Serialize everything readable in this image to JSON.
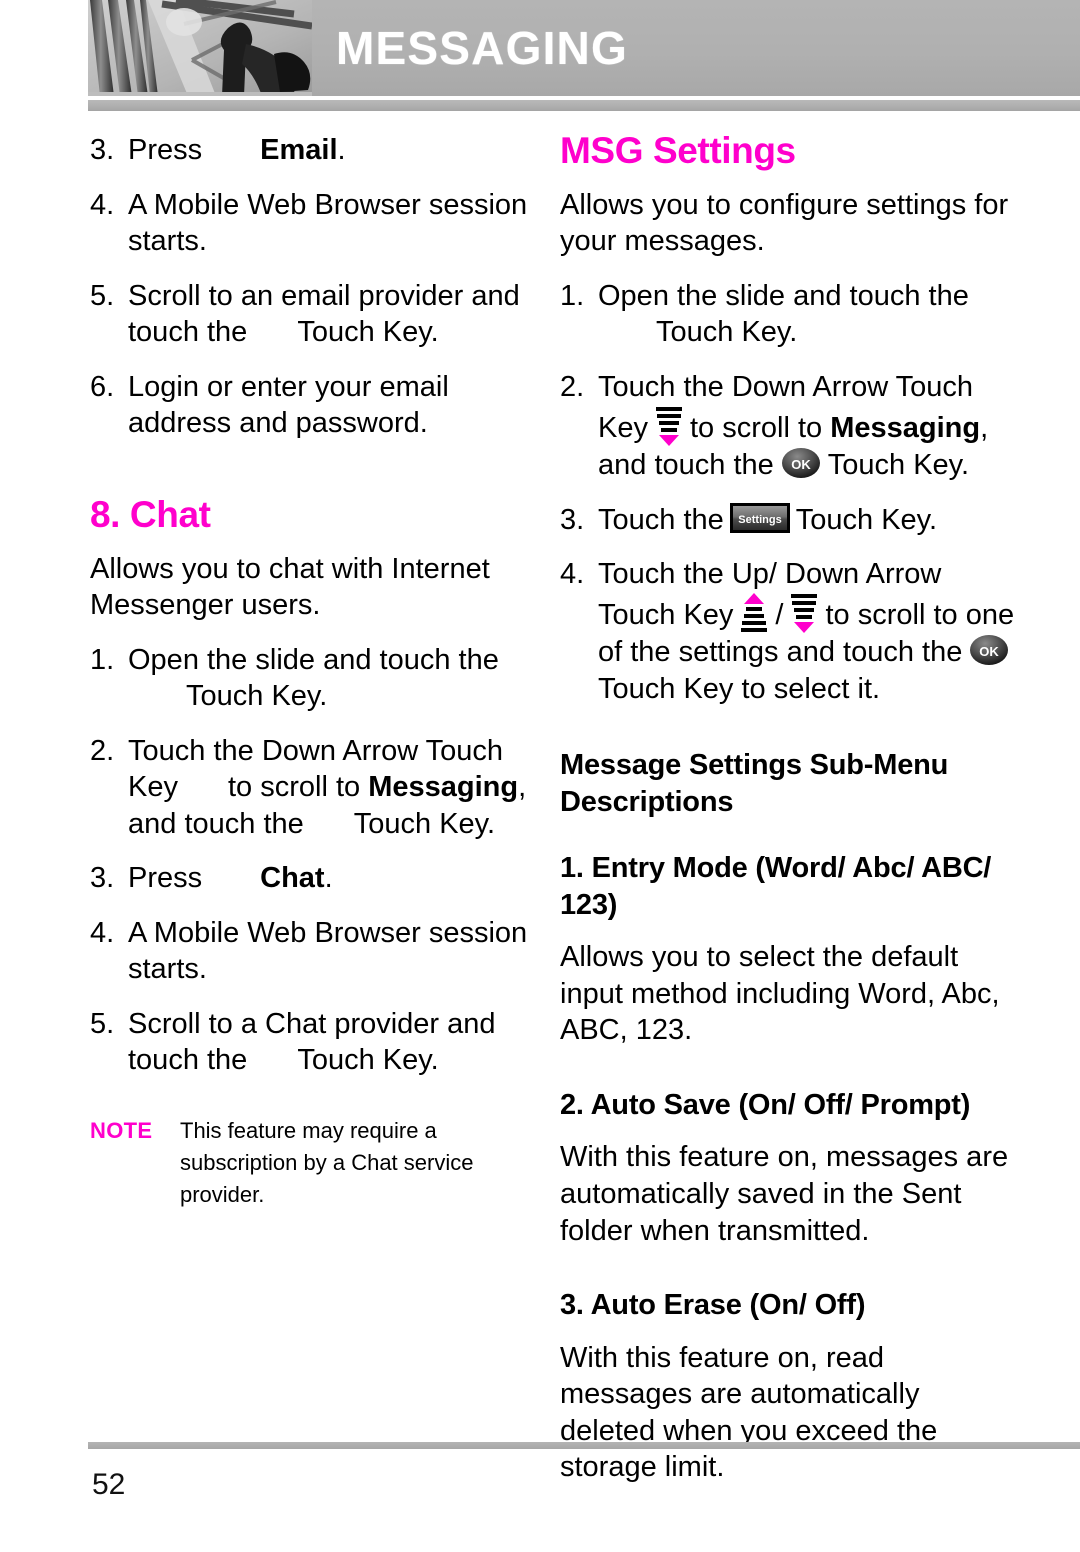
{
  "header": {
    "title": "MESSAGING",
    "photo_alt": "grayscale-photo-scaffolding-poles",
    "banner_color": "#b0b0b0",
    "title_color": "#ffffff"
  },
  "accent_color": "#ff00cc",
  "left_column": {
    "steps_email": [
      {
        "num": "3.",
        "pre": "Press",
        "icon": "menu-key-icon",
        "bold": "Email",
        "post": "."
      },
      {
        "num": "4.",
        "text": "A Mobile Web Browser session starts."
      },
      {
        "num": "5.",
        "pre": "Scroll to an email provider and touch the",
        "icon": "ok-key-icon",
        "post": "Touch Key."
      },
      {
        "num": "6.",
        "text": "Login or enter your email address and password."
      }
    ],
    "chat_section": {
      "title": "8. Chat",
      "intro": "Allows you to chat with Internet Messenger users.",
      "steps": [
        {
          "num": "1.",
          "pre": "Open the slide and touch the",
          "icon": "menu-key-icon",
          "post": "Touch Key."
        },
        {
          "num": "2.",
          "pre": "Touch the Down Arrow Touch Key",
          "icon": "down-arrow-key-icon",
          "mid": "to scroll to",
          "bold": "Messaging",
          "post2": ", and touch the",
          "icon2": "ok-key-icon",
          "post3": "Touch Key."
        },
        {
          "num": "3.",
          "pre": "Press",
          "icon": "menu-key-icon",
          "bold": "Chat",
          "post": "."
        },
        {
          "num": "4.",
          "text": "A Mobile Web Browser session starts."
        },
        {
          "num": "5.",
          "pre": "Scroll to a Chat provider and touch the",
          "icon": "ok-key-icon",
          "post": "Touch Key."
        }
      ],
      "note": {
        "label": "NOTE",
        "text": "This feature may require a subscription by a Chat service provider."
      }
    }
  },
  "right_column": {
    "msg_settings": {
      "title": "MSG Settings",
      "intro": "Allows you to configure settings for your messages.",
      "steps": [
        {
          "num": "1.",
          "pre": "Open the slide and touch the",
          "icon": "menu-key-icon",
          "post": "Touch Key."
        },
        {
          "num": "2.",
          "pre": "Touch the Down Arrow Touch Key",
          "icon": "down-arrow-key-icon",
          "mid": "to scroll to",
          "bold": "Messaging",
          "post2": ", and touch the",
          "icon2": "ok-key-icon",
          "post3": "Touch Key."
        },
        {
          "num": "3.",
          "pre": "Touch the",
          "icon": "settings-key-icon",
          "post": "Touch Key."
        },
        {
          "num": "4.",
          "pre": "Touch the Up/ Down Arrow Touch Key",
          "icon": "up-arrow-key-icon",
          "sep": "/",
          "icon2": "down-arrow-key-icon",
          "mid": "to scroll to one of the settings and touch the",
          "icon3": "ok-key-icon",
          "post": "Touch Key to select it."
        }
      ]
    },
    "submenu": {
      "heading": "Message Settings Sub-Menu Descriptions",
      "items": [
        {
          "title": "1. Entry Mode (Word/ Abc/ ABC/ 123)",
          "body": "Allows you to select the default input method including Word, Abc, ABC, 123."
        },
        {
          "title": "2. Auto Save (On/ Off/ Prompt)",
          "body": "With this feature on, messages are automatically saved in the Sent folder when transmitted."
        },
        {
          "title": "3. Auto Erase (On/ Off)",
          "body": "With this feature on, read messages are automatically deleted when you exceed the storage limit."
        }
      ]
    }
  },
  "footer": {
    "page_number": "52"
  },
  "icons": {
    "ok_key_label": "OK",
    "settings_key_label": "Settings"
  }
}
